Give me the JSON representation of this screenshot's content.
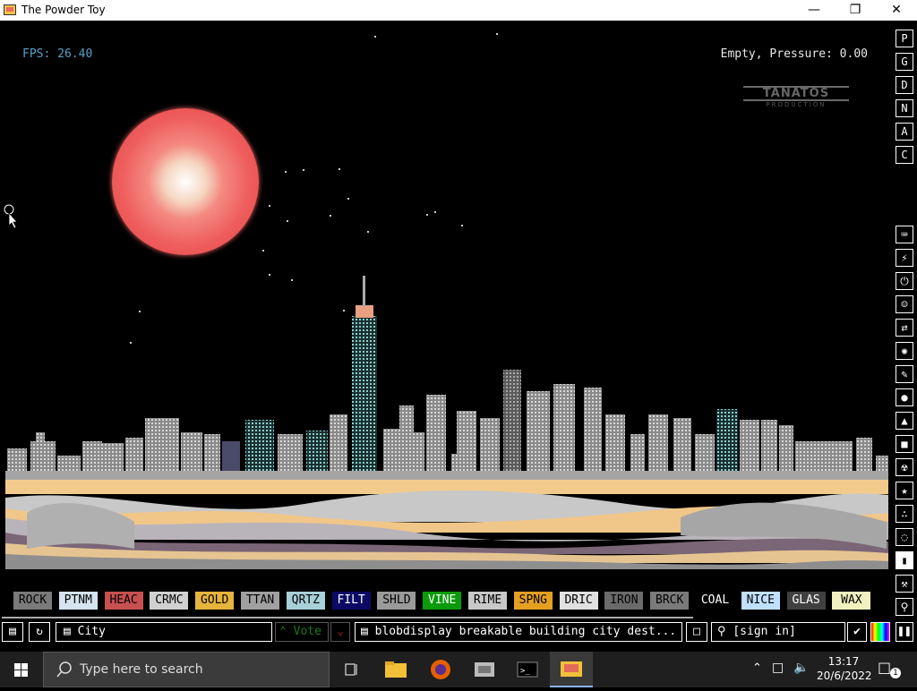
{
  "window": {
    "title": "The Powder Toy",
    "minimize_icon": "minimize-icon",
    "maximize_icon": "restore-icon",
    "close_icon": "close-icon"
  },
  "hud": {
    "fps": "FPS: 26.40",
    "status": "Empty, Pressure: 0.00"
  },
  "logo": {
    "line1": "TANATOS",
    "line2": "PRODUCTION"
  },
  "right_menu_top": [
    "P",
    "G",
    "D",
    "N",
    "A",
    "C"
  ],
  "right_menu_icons": [
    "keyboard-icon",
    "plug-icon",
    "power-icon",
    "force-icon",
    "arrows-icon",
    "explosives-icon",
    "pen-icon",
    "drop-icon",
    "flask-icon",
    "solid-icon",
    "radiation-icon",
    "star-icon",
    "powder-icon",
    "bulb-icon",
    "bookmark-icon",
    "hammer-icon",
    "search-icon"
  ],
  "elements": [
    {
      "label": "ROCK",
      "bg": "#7a7a7a",
      "fg": "#000000"
    },
    {
      "label": "PTNM",
      "bg": "#d4e4f0",
      "fg": "#000000"
    },
    {
      "label": "HEAC",
      "bg": "#c85050",
      "fg": "#000000"
    },
    {
      "label": "CRMC",
      "bg": "#d0d0d0",
      "fg": "#000000"
    },
    {
      "label": "GOLD",
      "bg": "#e6b33c",
      "fg": "#000000"
    },
    {
      "label": "TTAN",
      "bg": "#a0a0a0",
      "fg": "#000000"
    },
    {
      "label": "QRTZ",
      "bg": "#a8d0d8",
      "fg": "#000000"
    },
    {
      "label": "FILT",
      "bg": "#0a0a64",
      "fg": "#ffffff"
    },
    {
      "label": "SHLD",
      "bg": "#9a9a9a",
      "fg": "#000000"
    },
    {
      "label": "VINE",
      "bg": "#0a9a0a",
      "fg": "#ffffff"
    },
    {
      "label": "RIME",
      "bg": "#c8c8c8",
      "fg": "#000000"
    },
    {
      "label": "SPNG",
      "bg": "#e6a020",
      "fg": "#000000"
    },
    {
      "label": "DRIC",
      "bg": "#e0e0e0",
      "fg": "#000000"
    },
    {
      "label": "IRON",
      "bg": "#6a6a6a",
      "fg": "#000000"
    },
    {
      "label": "BRCK",
      "bg": "#7a7a7a",
      "fg": "#000000"
    },
    {
      "label": "COAL",
      "bg": "#000000",
      "fg": "#ffffff"
    },
    {
      "label": "NICE",
      "bg": "#c0e0ff",
      "fg": "#000000"
    },
    {
      "label": "GLAS",
      "bg": "#404040",
      "fg": "#ffffff"
    },
    {
      "label": "WAX",
      "bg": "#f0f0c0",
      "fg": "#000000"
    }
  ],
  "toolbar": {
    "save_name": "City",
    "vote_label": "Vote",
    "tags": "blobdisplay breakable building city dest...",
    "sign_in": "[sign in]"
  },
  "taskbar": {
    "search_placeholder": "Type here to search",
    "time": "13:17",
    "date": "20/6/2022",
    "notifications": "1"
  }
}
